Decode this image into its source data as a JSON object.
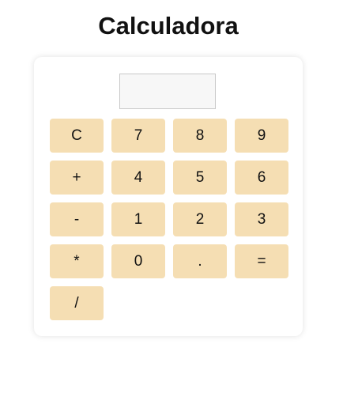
{
  "app": {
    "title": "Calculadora"
  },
  "display": {
    "value": ""
  },
  "buttons": [
    {
      "label": "C"
    },
    {
      "label": "7"
    },
    {
      "label": "8"
    },
    {
      "label": "9"
    },
    {
      "label": "+"
    },
    {
      "label": "4"
    },
    {
      "label": "5"
    },
    {
      "label": "6"
    },
    {
      "label": "-"
    },
    {
      "label": "1"
    },
    {
      "label": "2"
    },
    {
      "label": "3"
    },
    {
      "label": "*"
    },
    {
      "label": "0"
    },
    {
      "label": "."
    },
    {
      "label": "="
    },
    {
      "label": "/"
    }
  ],
  "colors": {
    "button_bg": "#f5deb3",
    "display_bg": "#f7f7f7",
    "card_bg": "#ffffff"
  }
}
